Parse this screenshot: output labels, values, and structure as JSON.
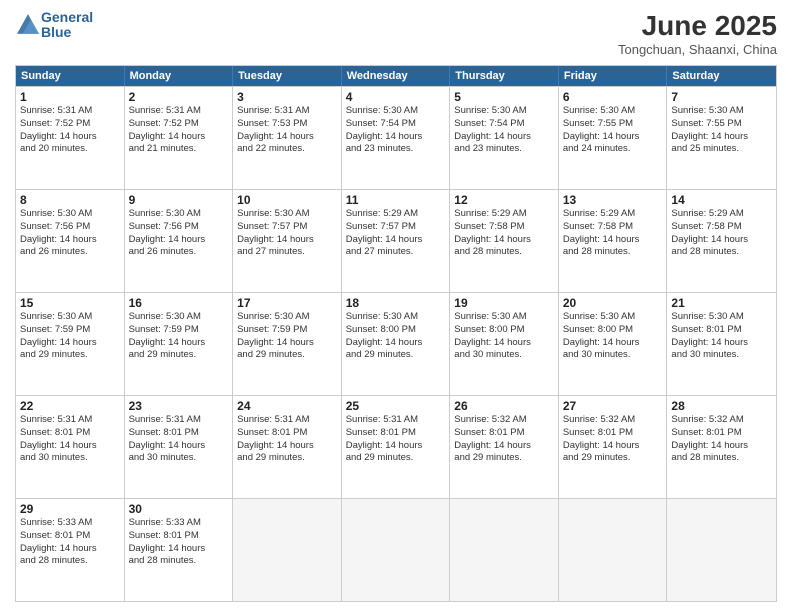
{
  "logo": {
    "line1": "General",
    "line2": "Blue"
  },
  "title": "June 2025",
  "subtitle": "Tongchuan, Shaanxi, China",
  "headers": [
    "Sunday",
    "Monday",
    "Tuesday",
    "Wednesday",
    "Thursday",
    "Friday",
    "Saturday"
  ],
  "rows": [
    [
      {
        "day": "1",
        "lines": [
          "Sunrise: 5:31 AM",
          "Sunset: 7:52 PM",
          "Daylight: 14 hours",
          "and 20 minutes."
        ]
      },
      {
        "day": "2",
        "lines": [
          "Sunrise: 5:31 AM",
          "Sunset: 7:52 PM",
          "Daylight: 14 hours",
          "and 21 minutes."
        ]
      },
      {
        "day": "3",
        "lines": [
          "Sunrise: 5:31 AM",
          "Sunset: 7:53 PM",
          "Daylight: 14 hours",
          "and 22 minutes."
        ]
      },
      {
        "day": "4",
        "lines": [
          "Sunrise: 5:30 AM",
          "Sunset: 7:54 PM",
          "Daylight: 14 hours",
          "and 23 minutes."
        ]
      },
      {
        "day": "5",
        "lines": [
          "Sunrise: 5:30 AM",
          "Sunset: 7:54 PM",
          "Daylight: 14 hours",
          "and 23 minutes."
        ]
      },
      {
        "day": "6",
        "lines": [
          "Sunrise: 5:30 AM",
          "Sunset: 7:55 PM",
          "Daylight: 14 hours",
          "and 24 minutes."
        ]
      },
      {
        "day": "7",
        "lines": [
          "Sunrise: 5:30 AM",
          "Sunset: 7:55 PM",
          "Daylight: 14 hours",
          "and 25 minutes."
        ]
      }
    ],
    [
      {
        "day": "8",
        "lines": [
          "Sunrise: 5:30 AM",
          "Sunset: 7:56 PM",
          "Daylight: 14 hours",
          "and 26 minutes."
        ]
      },
      {
        "day": "9",
        "lines": [
          "Sunrise: 5:30 AM",
          "Sunset: 7:56 PM",
          "Daylight: 14 hours",
          "and 26 minutes."
        ]
      },
      {
        "day": "10",
        "lines": [
          "Sunrise: 5:30 AM",
          "Sunset: 7:57 PM",
          "Daylight: 14 hours",
          "and 27 minutes."
        ]
      },
      {
        "day": "11",
        "lines": [
          "Sunrise: 5:29 AM",
          "Sunset: 7:57 PM",
          "Daylight: 14 hours",
          "and 27 minutes."
        ]
      },
      {
        "day": "12",
        "lines": [
          "Sunrise: 5:29 AM",
          "Sunset: 7:58 PM",
          "Daylight: 14 hours",
          "and 28 minutes."
        ]
      },
      {
        "day": "13",
        "lines": [
          "Sunrise: 5:29 AM",
          "Sunset: 7:58 PM",
          "Daylight: 14 hours",
          "and 28 minutes."
        ]
      },
      {
        "day": "14",
        "lines": [
          "Sunrise: 5:29 AM",
          "Sunset: 7:58 PM",
          "Daylight: 14 hours",
          "and 28 minutes."
        ]
      }
    ],
    [
      {
        "day": "15",
        "lines": [
          "Sunrise: 5:30 AM",
          "Sunset: 7:59 PM",
          "Daylight: 14 hours",
          "and 29 minutes."
        ]
      },
      {
        "day": "16",
        "lines": [
          "Sunrise: 5:30 AM",
          "Sunset: 7:59 PM",
          "Daylight: 14 hours",
          "and 29 minutes."
        ]
      },
      {
        "day": "17",
        "lines": [
          "Sunrise: 5:30 AM",
          "Sunset: 7:59 PM",
          "Daylight: 14 hours",
          "and 29 minutes."
        ]
      },
      {
        "day": "18",
        "lines": [
          "Sunrise: 5:30 AM",
          "Sunset: 8:00 PM",
          "Daylight: 14 hours",
          "and 29 minutes."
        ]
      },
      {
        "day": "19",
        "lines": [
          "Sunrise: 5:30 AM",
          "Sunset: 8:00 PM",
          "Daylight: 14 hours",
          "and 30 minutes."
        ]
      },
      {
        "day": "20",
        "lines": [
          "Sunrise: 5:30 AM",
          "Sunset: 8:00 PM",
          "Daylight: 14 hours",
          "and 30 minutes."
        ]
      },
      {
        "day": "21",
        "lines": [
          "Sunrise: 5:30 AM",
          "Sunset: 8:01 PM",
          "Daylight: 14 hours",
          "and 30 minutes."
        ]
      }
    ],
    [
      {
        "day": "22",
        "lines": [
          "Sunrise: 5:31 AM",
          "Sunset: 8:01 PM",
          "Daylight: 14 hours",
          "and 30 minutes."
        ]
      },
      {
        "day": "23",
        "lines": [
          "Sunrise: 5:31 AM",
          "Sunset: 8:01 PM",
          "Daylight: 14 hours",
          "and 30 minutes."
        ]
      },
      {
        "day": "24",
        "lines": [
          "Sunrise: 5:31 AM",
          "Sunset: 8:01 PM",
          "Daylight: 14 hours",
          "and 29 minutes."
        ]
      },
      {
        "day": "25",
        "lines": [
          "Sunrise: 5:31 AM",
          "Sunset: 8:01 PM",
          "Daylight: 14 hours",
          "and 29 minutes."
        ]
      },
      {
        "day": "26",
        "lines": [
          "Sunrise: 5:32 AM",
          "Sunset: 8:01 PM",
          "Daylight: 14 hours",
          "and 29 minutes."
        ]
      },
      {
        "day": "27",
        "lines": [
          "Sunrise: 5:32 AM",
          "Sunset: 8:01 PM",
          "Daylight: 14 hours",
          "and 29 minutes."
        ]
      },
      {
        "day": "28",
        "lines": [
          "Sunrise: 5:32 AM",
          "Sunset: 8:01 PM",
          "Daylight: 14 hours",
          "and 28 minutes."
        ]
      }
    ],
    [
      {
        "day": "29",
        "lines": [
          "Sunrise: 5:33 AM",
          "Sunset: 8:01 PM",
          "Daylight: 14 hours",
          "and 28 minutes."
        ]
      },
      {
        "day": "30",
        "lines": [
          "Sunrise: 5:33 AM",
          "Sunset: 8:01 PM",
          "Daylight: 14 hours",
          "and 28 minutes."
        ]
      },
      {
        "day": "",
        "lines": []
      },
      {
        "day": "",
        "lines": []
      },
      {
        "day": "",
        "lines": []
      },
      {
        "day": "",
        "lines": []
      },
      {
        "day": "",
        "lines": []
      }
    ]
  ]
}
